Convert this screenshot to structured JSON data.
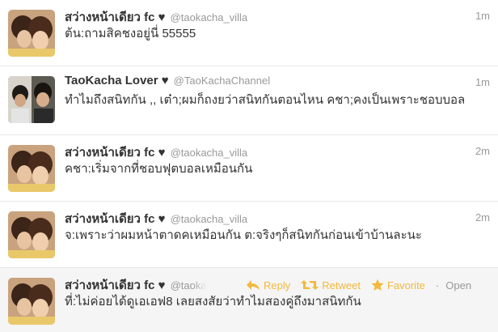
{
  "tweets": [
    {
      "name": "สว่างหน้าเดียว fc ♥",
      "handle": "@taokacha_villa",
      "time": "1m",
      "text": "ต้น:ถามสิคชงอยู่นี่ 55555"
    },
    {
      "name": "TaoKacha Lover ♥",
      "handle": "@TaoKachaChannel",
      "time": "1m",
      "text": "ทำไมถึงสนิทกัน ,, เต๋า;ผมก็ถงยว่าสนิทกันตอนไหน คชา;คงเป็นเพราะชอบบอล"
    },
    {
      "name": "สว่างหน้าเดียว fc ♥",
      "handle": "@taokacha_villa",
      "time": "2m",
      "text": "คชา:เริ่มจากที่ชอบฟุตบอลเหมือนกัน"
    },
    {
      "name": "สว่างหน้าเดียว fc ♥",
      "handle": "@taokacha_villa",
      "time": "2m",
      "text": "จ:เพราะว่าผมหน้าตาดคเหมือนกัน ต:จริงๆก็สนิทกันก่อนเข้าบ้านละนะ"
    },
    {
      "name": "สว่างหน้าเดียว fc ♥",
      "handle": "@taoka",
      "time": "",
      "text": "ที่:ไม่ค่อยได้ดูเอเอฟ8 เลยสงสัยว่าทำไมสองคู่ถึงมาสนิทกัน"
    }
  ],
  "actions": {
    "reply": "Reply",
    "retweet": "Retweet",
    "favorite": "Favorite",
    "separator": "·",
    "open": "Open"
  },
  "colors": {
    "action": "#f3b93d",
    "name": "#333333",
    "meta": "#999999"
  }
}
